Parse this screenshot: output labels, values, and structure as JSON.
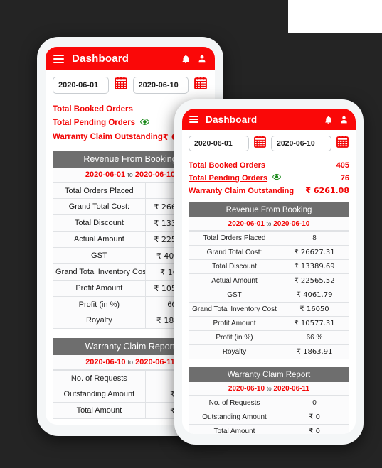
{
  "background_color": "#242424",
  "accent_color": "#fa0808",
  "header_gray": "#6e6e6e",
  "eye_icon_color": "#1a8a1a",
  "app": {
    "title": "Dashboard",
    "menu_icon": "hamburger-icon",
    "notification_icon": "bell-icon",
    "account_icon": "person-icon"
  },
  "filter": {
    "start_date": "2020-06-01",
    "end_date": "2020-06-10",
    "start_placeholder": "yyyy-mm-dd",
    "end_placeholder": "yyyy-mm-dd",
    "calendar_icon": "calendar-icon"
  },
  "summary": {
    "rows": [
      {
        "label": "Total Booked Orders",
        "value": "405",
        "underlined": false,
        "has_eye": false
      },
      {
        "label": "Total Pending Orders",
        "value": "76",
        "underlined": true,
        "has_eye": true
      },
      {
        "label": "Warranty Claim Outstanding",
        "value": "₹ 6261.08",
        "underlined": false,
        "has_eye": false
      }
    ]
  },
  "revenue_card": {
    "title": "Revenue From Booking",
    "range_start": "2020-06-01",
    "range_sep": "to",
    "range_end": "2020-06-10",
    "rows": [
      {
        "label": "Total Orders Placed",
        "value": "8"
      },
      {
        "label": "Grand Total Cost:",
        "value": "₹ 26627.31"
      },
      {
        "label": "Total Discount",
        "value": "₹ 13389.69"
      },
      {
        "label": "Actual Amount",
        "value": "₹ 22565.52"
      },
      {
        "label": "GST",
        "value": "₹ 4061.79"
      },
      {
        "label": "Grand Total Inventory Cost",
        "value": "₹ 16050"
      },
      {
        "label": "Profit Amount",
        "value": "₹ 10577.31"
      },
      {
        "label": "Profit (in %)",
        "value": "66 %"
      },
      {
        "label": "Royalty",
        "value": "₹ 1863.91"
      }
    ]
  },
  "warranty_card": {
    "title": "Warranty Claim Report",
    "range_start": "2020-06-10",
    "range_sep": "to",
    "range_end": "2020-06-11",
    "rows": [
      {
        "label": "No. of Requests",
        "value": "0"
      },
      {
        "label": "Outstanding Amount",
        "value": "₹ 0"
      },
      {
        "label": "Total Amount",
        "value": "₹ 0"
      }
    ]
  }
}
